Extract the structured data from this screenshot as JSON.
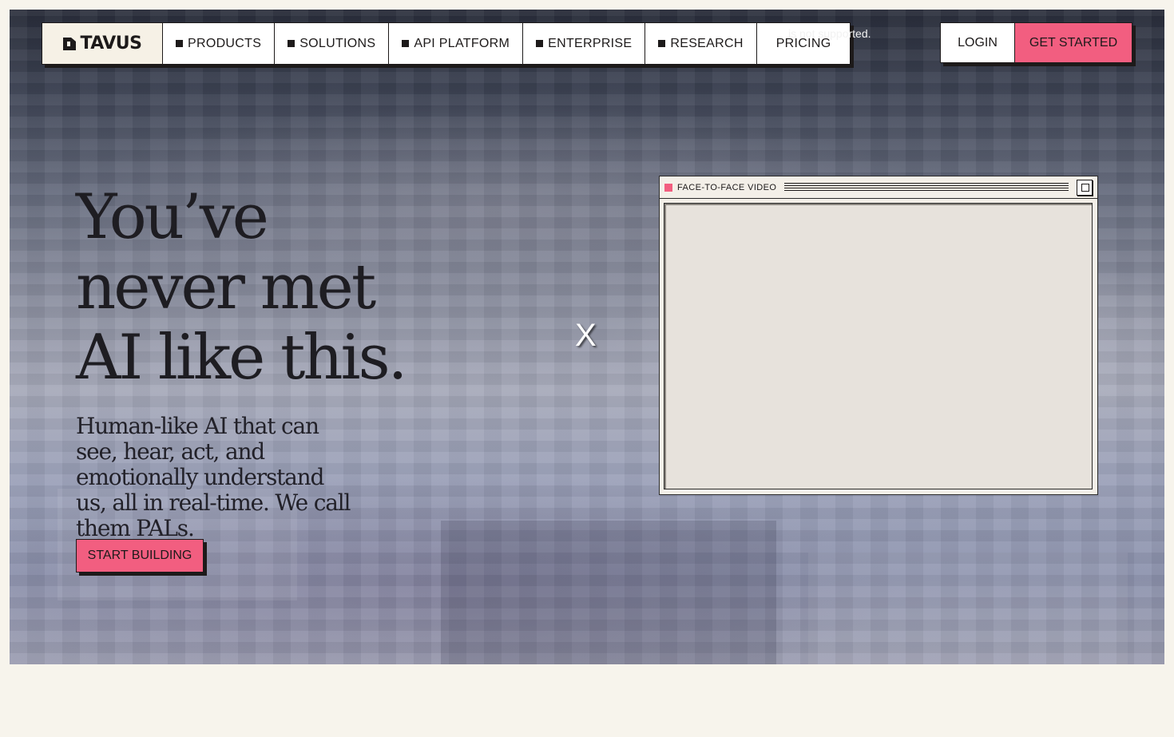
{
  "brand": {
    "name": "TAVUS"
  },
  "nav": {
    "items": [
      {
        "label": "PRODUCTS",
        "marker": true
      },
      {
        "label": "SOLUTIONS",
        "marker": true
      },
      {
        "label": "API PLATFORM",
        "marker": true
      },
      {
        "label": "ENTERPRISE",
        "marker": true
      },
      {
        "label": "RESEARCH",
        "marker": true
      },
      {
        "label": "PRICING",
        "marker": false
      }
    ],
    "notice": "is not supported.",
    "login_label": "LOGIN",
    "get_started_label": "GET STARTED"
  },
  "hero": {
    "headline_lines": [
      "You’ve",
      "never met",
      "AI like this."
    ],
    "subheadline": "Human-like AI that can see, hear, act, and emotionally understand us, all in real-time. We call them PALs.",
    "cta_label": "START BUILDING",
    "close_label": "X"
  },
  "video_window": {
    "title": "FACE-TO-FACE VIDEO"
  },
  "colors": {
    "accent": "#f25e80",
    "ink": "#1d1a1a",
    "page_bg": "#f7f4ec"
  }
}
